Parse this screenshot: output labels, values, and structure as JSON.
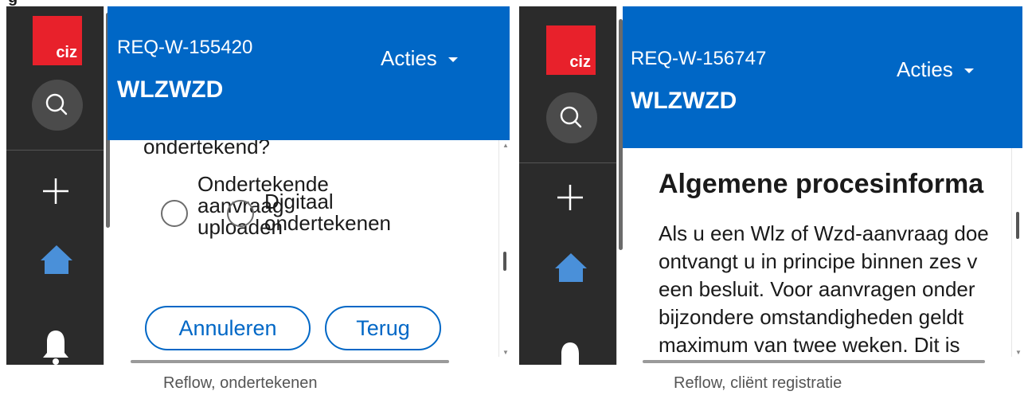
{
  "top_fragment": "g",
  "left": {
    "sidebar": {
      "logo_text": "ciz"
    },
    "header": {
      "request_id": "REQ-W-155420",
      "tenant": "WLZWZD",
      "actions_label": "Acties"
    },
    "question_tail": "ondertekend?",
    "options": [
      "Ondertekende aanvraag uploaden",
      "Digitaal ondertekenen"
    ],
    "buttons": {
      "cancel": "Annuleren",
      "back": "Terug"
    },
    "caption": "Reflow, ondertekenen"
  },
  "right": {
    "sidebar": {
      "logo_text": "ciz"
    },
    "header": {
      "request_id": "REQ-W-156747",
      "tenant": "WLZWZD",
      "actions_label": "Acties"
    },
    "heading": "Algemene procesinforma",
    "paragraph_lines": [
      "Als u een Wlz of Wzd-aanvraag doe",
      "ontvangt u in principe binnen zes v",
      "een besluit. Voor aanvragen onder",
      "bijzondere omstandigheden geldt",
      "maximum van twee weken. Dit is"
    ],
    "caption": "Reflow, cliënt registratie"
  }
}
